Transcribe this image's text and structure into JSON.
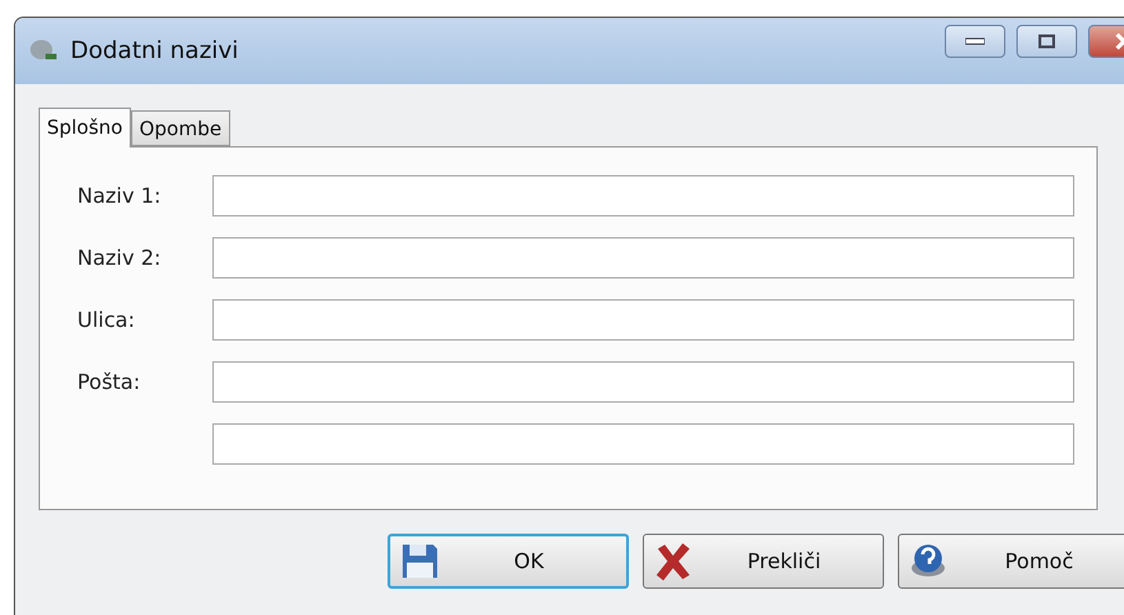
{
  "window": {
    "title": "Dodatni nazivi"
  },
  "tabs": [
    {
      "label": "Splošno",
      "selected": true
    },
    {
      "label": "Opombe",
      "selected": false
    }
  ],
  "fields": [
    {
      "kind": "labeled",
      "label": "Naziv 1:"
    },
    {
      "kind": "labeled",
      "label": "Naziv 2:"
    },
    {
      "kind": "labeled",
      "label": "Ulica:"
    },
    {
      "kind": "labeled",
      "label": "Pošta:"
    },
    {
      "kind": "plain"
    }
  ],
  "buttons": [
    {
      "label": "OK",
      "kind": "ok",
      "focused": true
    },
    {
      "label": "Prekliči",
      "kind": "cancel",
      "focused": false
    },
    {
      "label": "Pomoč",
      "kind": "help",
      "focused": false
    }
  ]
}
